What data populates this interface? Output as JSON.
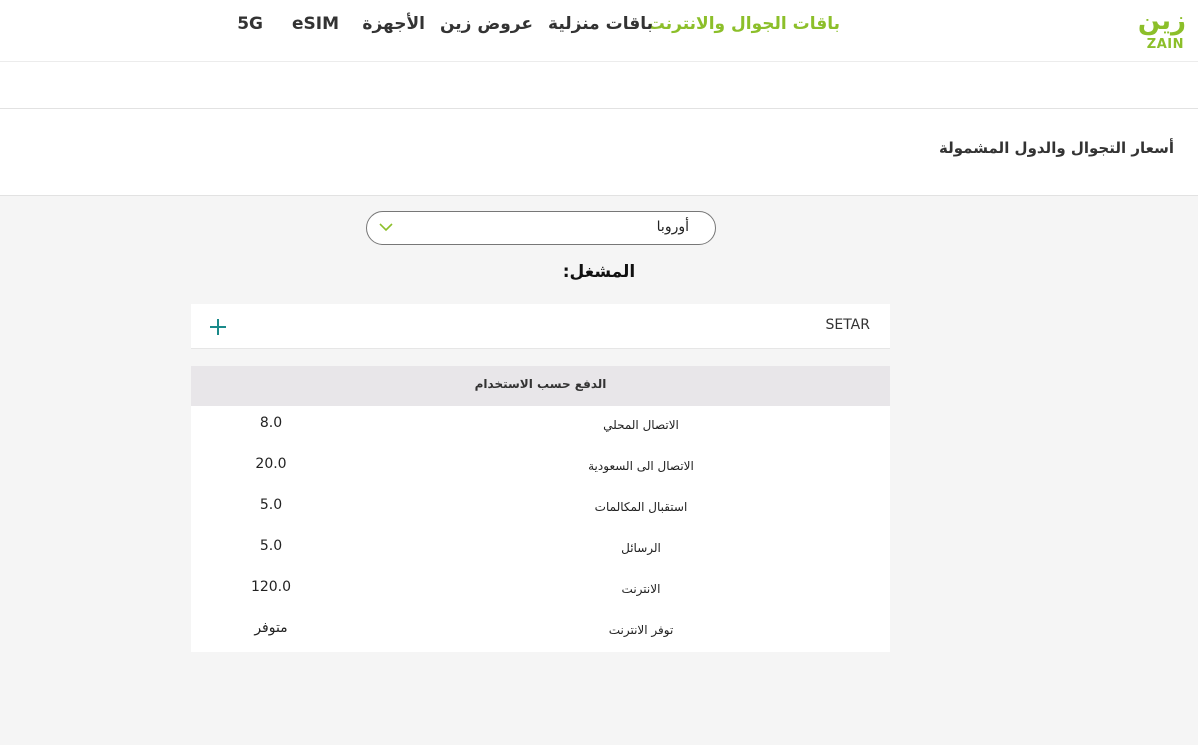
{
  "header": {
    "logo_ar": "زين",
    "logo_en": "ZAIN",
    "nav": [
      {
        "label": "باقات الجوال والانترنت",
        "active": true
      },
      {
        "label": "باقات منزلية",
        "active": false
      },
      {
        "label": "عروض زين",
        "active": false
      },
      {
        "label": "الأجهزة",
        "active": false
      },
      {
        "label": "eSIM",
        "active": false
      },
      {
        "label": "5G",
        "active": false
      }
    ]
  },
  "page": {
    "title": "أسعار التجوال والدول المشمولة"
  },
  "region_select": {
    "value": "أوروبا"
  },
  "operator": {
    "heading": "المشغل:",
    "name": "SETAR"
  },
  "rates_table": {
    "header": "الدفع حسب الاستخدام",
    "rows": [
      {
        "label": "الاتصال المحلي",
        "value": "8.0"
      },
      {
        "label": "الاتصال الى السعودية",
        "value": "20.0"
      },
      {
        "label": "استقبال المكالمات",
        "value": "5.0"
      },
      {
        "label": "الرسائل",
        "value": "5.0"
      },
      {
        "label": "الانترنت",
        "value": "120.0"
      },
      {
        "label": "توفر الانترنت",
        "value": "متوفر"
      }
    ]
  },
  "colors": {
    "brand_green": "#8cbf2a",
    "plus_teal": "#1a8a8a"
  }
}
